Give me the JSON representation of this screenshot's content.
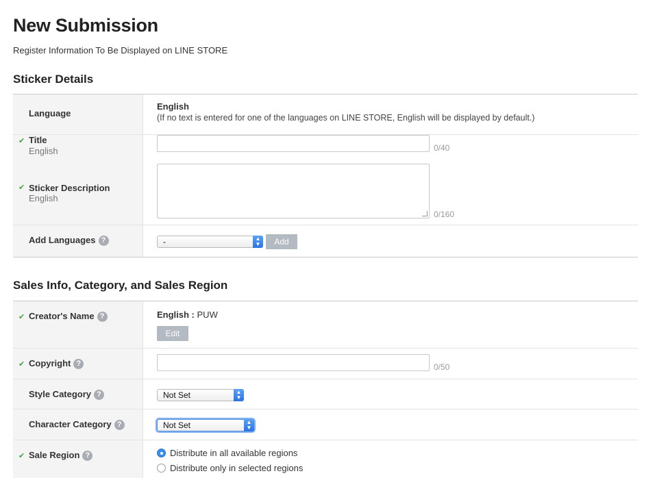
{
  "page": {
    "title": "New Submission",
    "subtitle": "Register Information To Be Displayed on LINE STORE"
  },
  "sticker_details": {
    "section_title": "Sticker Details",
    "language": {
      "label": "Language",
      "value": "English",
      "note": "(If no text is entered for one of the languages on LINE STORE, English will be displayed by default.)"
    },
    "title_field": {
      "label": "Title",
      "sublabel": "English",
      "value": "",
      "counter": "0/40"
    },
    "description_field": {
      "label": "Sticker Description",
      "sublabel": "English",
      "value": "",
      "counter": "0/160"
    },
    "add_languages": {
      "label": "Add Languages",
      "help": "?",
      "selected": "-",
      "button": "Add"
    }
  },
  "sales_info": {
    "section_title": "Sales Info, Category, and Sales Region",
    "creator_name": {
      "label": "Creator's Name",
      "help": "?",
      "lang": "English :",
      "value": "PUW",
      "edit_button": "Edit"
    },
    "copyright": {
      "label": "Copyright",
      "help": "?",
      "value": "",
      "counter": "0/50"
    },
    "style_category": {
      "label": "Style Category",
      "help": "?",
      "selected": "Not Set"
    },
    "character_category": {
      "label": "Character Category",
      "help": "?",
      "selected": "Not Set"
    },
    "sale_region": {
      "label": "Sale Region",
      "help": "?",
      "option_all": "Distribute in all available regions",
      "option_selected": "Distribute only in selected regions",
      "checked": "option_all"
    }
  },
  "icons": {
    "check": "✔",
    "select_arrows": "up-down-chevron-icon"
  },
  "colors": {
    "check_green": "#3aa640",
    "help_gray": "#a9adb3",
    "button_gray": "#b3bac2",
    "select_blue": "#2a73e0"
  }
}
